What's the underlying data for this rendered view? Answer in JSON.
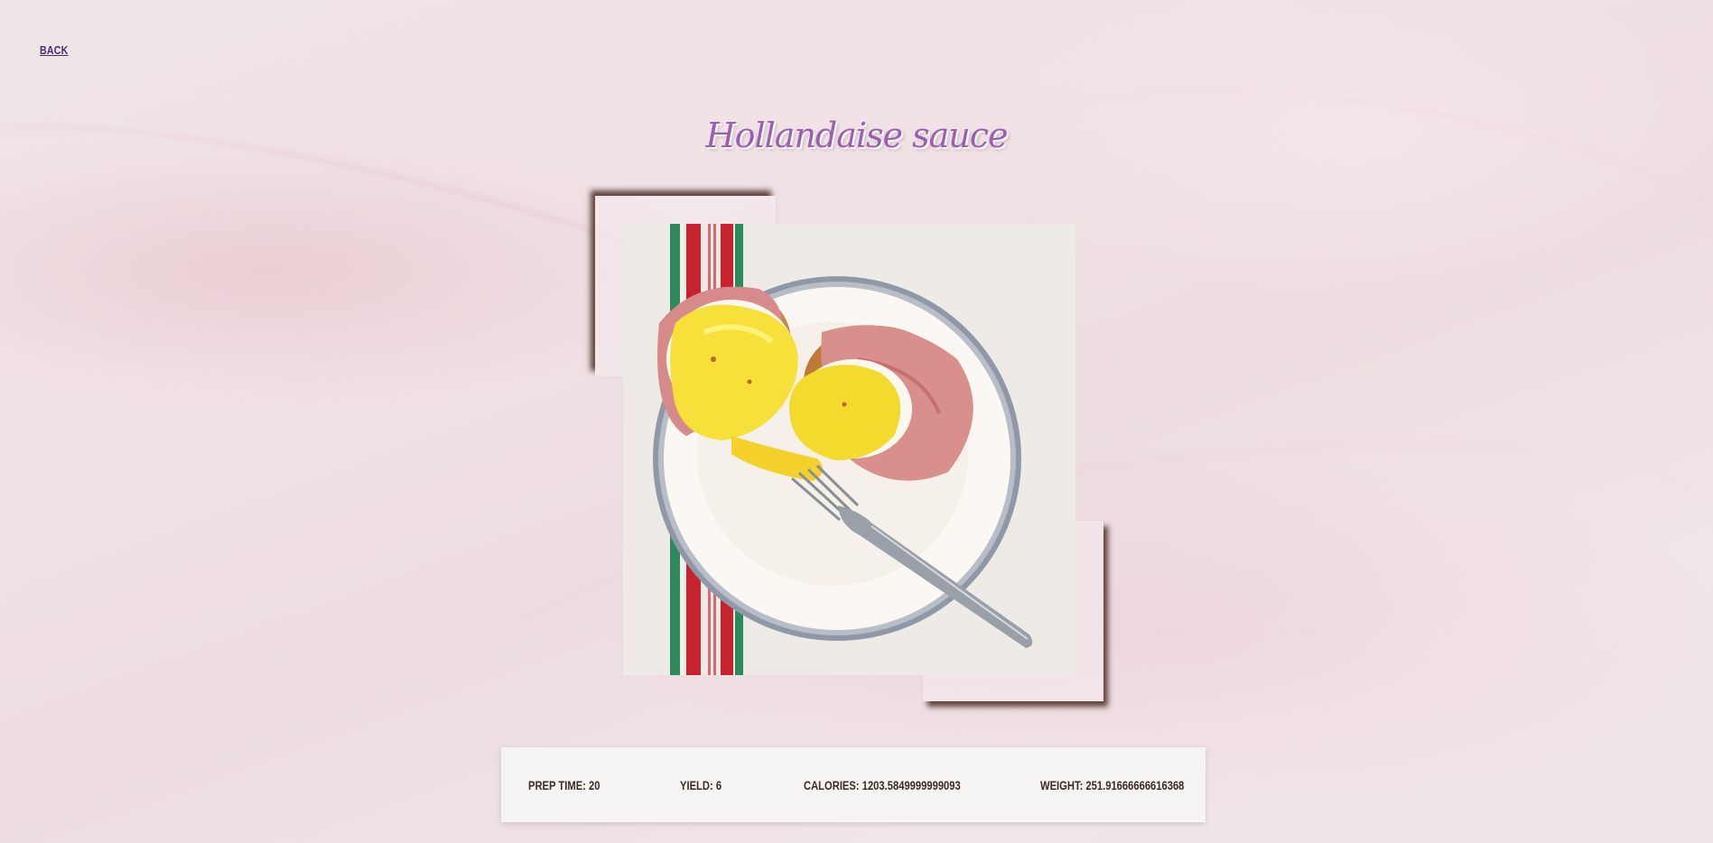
{
  "nav": {
    "back_label": "BACK"
  },
  "recipe": {
    "title": "Hollandaise sauce",
    "image_alt": "Eggs benedict with hollandaise sauce on a white plate with a fork"
  },
  "stats": [
    {
      "label": "PREP TIME",
      "value": "20"
    },
    {
      "label": "YIELD",
      "value": "6"
    },
    {
      "label": "CALORIES",
      "value": "1203.5849999999093"
    },
    {
      "label": "WEIGHT",
      "value": "251.91666666616368"
    }
  ],
  "colors": {
    "title": "#9b5fb0",
    "link": "#4b2a7a",
    "stat_text": "#3d2b21",
    "info_bar_bg": "#f6f4f3"
  }
}
